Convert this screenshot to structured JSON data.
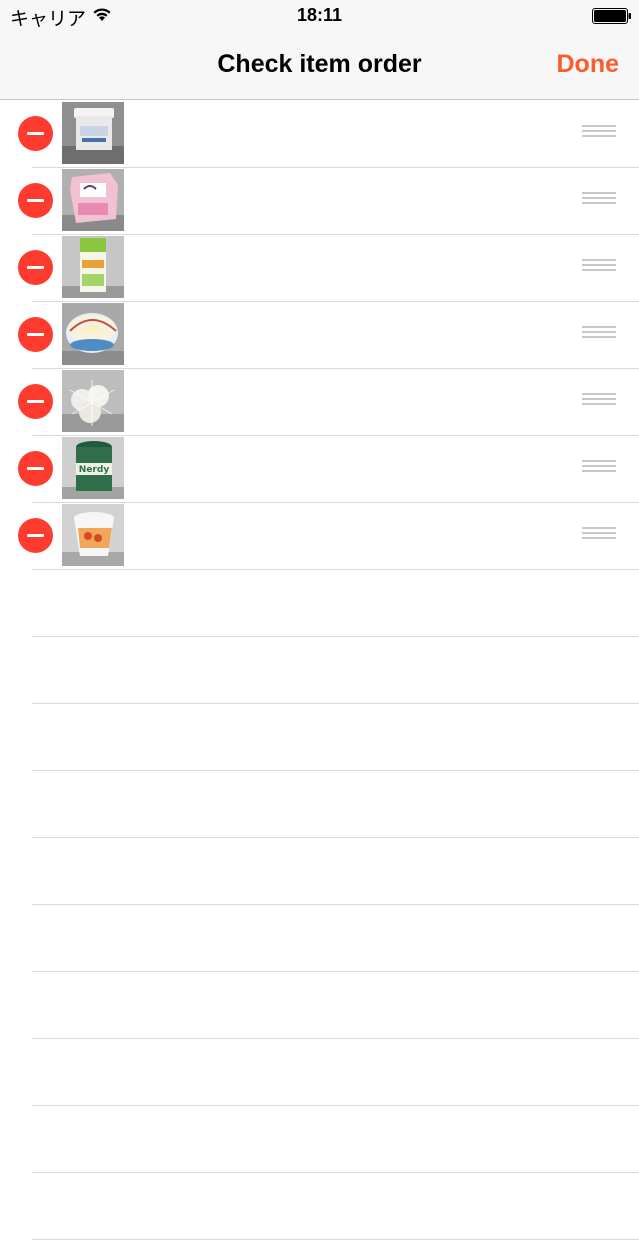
{
  "status_bar": {
    "carrier": "キャリア",
    "time": "18:11"
  },
  "nav": {
    "title": "Check item order",
    "done_label": "Done"
  },
  "colors": {
    "accent": "#ff5a2a",
    "delete": "#ff3b30",
    "separator": "#d9d9de",
    "nav_background": "#f7f7f7"
  },
  "items": [
    {
      "photo": "white-plastic-container"
    },
    {
      "photo": "pink-carton-box"
    },
    {
      "photo": "green-juice-carton"
    },
    {
      "photo": "round-cheese-box"
    },
    {
      "photo": "garlic-bulbs-in-net"
    },
    {
      "photo": "green-jar-with-label"
    },
    {
      "photo": "cup-with-orange-label"
    }
  ]
}
